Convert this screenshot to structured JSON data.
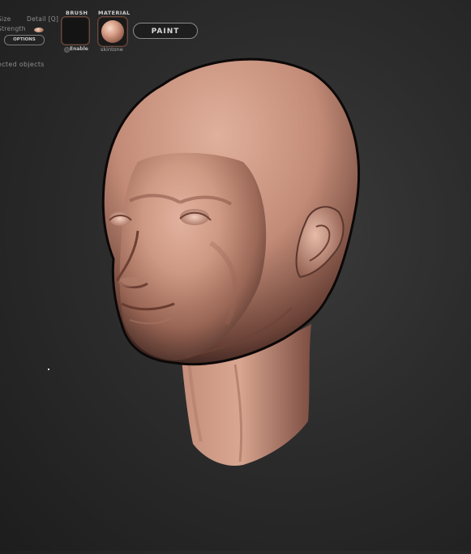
{
  "toolbar": {
    "size_label": "Size",
    "detail_label": "Detail [Q]",
    "strength_label": "Strength",
    "options_button": "OPTIONS",
    "brush": {
      "title": "BRUSH",
      "enable_label": "Enable"
    },
    "material": {
      "title": "MATERIAL",
      "name": "skintone"
    },
    "paint_button": "PAINT"
  },
  "viewport": {
    "selected_objects_label": "ected objects",
    "model": "sculpted-head",
    "material_color": "#d6a08a"
  }
}
